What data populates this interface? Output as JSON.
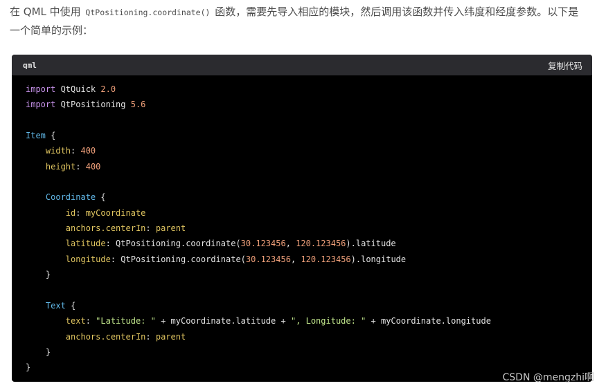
{
  "intro": {
    "line1_prefix": "在 QML 中使用 ",
    "inline_code": "QtPositioning.coordinate()",
    "line1_suffix": " 函数，需要先导入相应的模块，然后调用该函数并传入纬度和经度参数。以下是一个简单的示例："
  },
  "code_block": {
    "language": "qml",
    "copy_label": "复制代码",
    "lines": [
      [
        {
          "t": "import",
          "c": "kw"
        },
        {
          "t": " QtQuick ",
          "c": "plain"
        },
        {
          "t": "2.0",
          "c": "num"
        }
      ],
      [
        {
          "t": "import",
          "c": "kw"
        },
        {
          "t": " QtPositioning ",
          "c": "plain"
        },
        {
          "t": "5.6",
          "c": "num"
        }
      ],
      [],
      [
        {
          "t": "Item",
          "c": "type"
        },
        {
          "t": " {",
          "c": "plain"
        }
      ],
      [
        {
          "t": "    ",
          "c": "plain"
        },
        {
          "t": "width",
          "c": "prop"
        },
        {
          "t": ": ",
          "c": "plain"
        },
        {
          "t": "400",
          "c": "num"
        }
      ],
      [
        {
          "t": "    ",
          "c": "plain"
        },
        {
          "t": "height",
          "c": "prop"
        },
        {
          "t": ": ",
          "c": "plain"
        },
        {
          "t": "400",
          "c": "num"
        }
      ],
      [],
      [
        {
          "t": "    ",
          "c": "plain"
        },
        {
          "t": "Coordinate",
          "c": "type"
        },
        {
          "t": " {",
          "c": "plain"
        }
      ],
      [
        {
          "t": "        ",
          "c": "plain"
        },
        {
          "t": "id",
          "c": "prop"
        },
        {
          "t": ": ",
          "c": "plain"
        },
        {
          "t": "myCoordinate",
          "c": "prop"
        }
      ],
      [
        {
          "t": "        ",
          "c": "plain"
        },
        {
          "t": "anchors.centerIn",
          "c": "prop"
        },
        {
          "t": ": ",
          "c": "plain"
        },
        {
          "t": "parent",
          "c": "prop"
        }
      ],
      [
        {
          "t": "        ",
          "c": "plain"
        },
        {
          "t": "latitude",
          "c": "prop"
        },
        {
          "t": ": QtPositioning.coordinate(",
          "c": "plain"
        },
        {
          "t": "30.123456",
          "c": "num"
        },
        {
          "t": ", ",
          "c": "plain"
        },
        {
          "t": "120.123456",
          "c": "num"
        },
        {
          "t": ").latitude",
          "c": "plain"
        }
      ],
      [
        {
          "t": "        ",
          "c": "plain"
        },
        {
          "t": "longitude",
          "c": "prop"
        },
        {
          "t": ": QtPositioning.coordinate(",
          "c": "plain"
        },
        {
          "t": "30.123456",
          "c": "num"
        },
        {
          "t": ", ",
          "c": "plain"
        },
        {
          "t": "120.123456",
          "c": "num"
        },
        {
          "t": ").longitude",
          "c": "plain"
        }
      ],
      [
        {
          "t": "    }",
          "c": "plain"
        }
      ],
      [],
      [
        {
          "t": "    ",
          "c": "plain"
        },
        {
          "t": "Text",
          "c": "type"
        },
        {
          "t": " {",
          "c": "plain"
        }
      ],
      [
        {
          "t": "        ",
          "c": "plain"
        },
        {
          "t": "text",
          "c": "prop"
        },
        {
          "t": ": ",
          "c": "plain"
        },
        {
          "t": "\"Latitude: \"",
          "c": "str"
        },
        {
          "t": " + myCoordinate.latitude + ",
          "c": "plain"
        },
        {
          "t": "\", Longitude: \"",
          "c": "str"
        },
        {
          "t": " + myCoordinate.longitude",
          "c": "plain"
        }
      ],
      [
        {
          "t": "        ",
          "c": "plain"
        },
        {
          "t": "anchors.centerIn",
          "c": "prop"
        },
        {
          "t": ": ",
          "c": "plain"
        },
        {
          "t": "parent",
          "c": "prop"
        }
      ],
      [
        {
          "t": "    }",
          "c": "plain"
        }
      ],
      [
        {
          "t": "}",
          "c": "plain"
        }
      ]
    ]
  },
  "watermark": "CSDN @mengzhi啊"
}
